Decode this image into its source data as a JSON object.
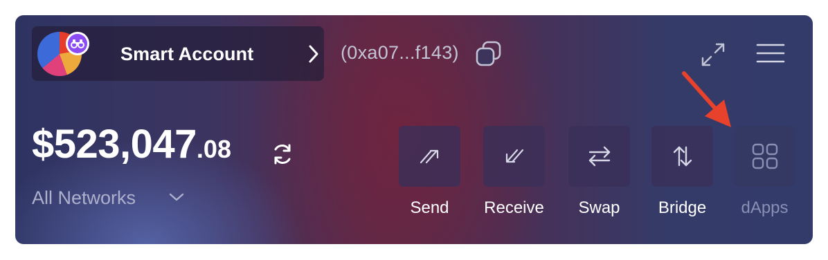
{
  "account": {
    "name": "Smart Account",
    "address": "(0xa07...f143)"
  },
  "balance": {
    "main": "$523,047",
    "cents": ".08"
  },
  "network": {
    "selected": "All Networks"
  },
  "actions": [
    {
      "label": "Send",
      "icon": "send-icon"
    },
    {
      "label": "Receive",
      "icon": "receive-icon"
    },
    {
      "label": "Swap",
      "icon": "swap-icon"
    },
    {
      "label": "Bridge",
      "icon": "bridge-icon"
    },
    {
      "label": "dApps",
      "icon": "grid-icon"
    }
  ],
  "colors": {
    "annotation_arrow": "#e8412c",
    "avatar_badge": "#8b4bf5",
    "muted_label": "#8a8fb4"
  }
}
